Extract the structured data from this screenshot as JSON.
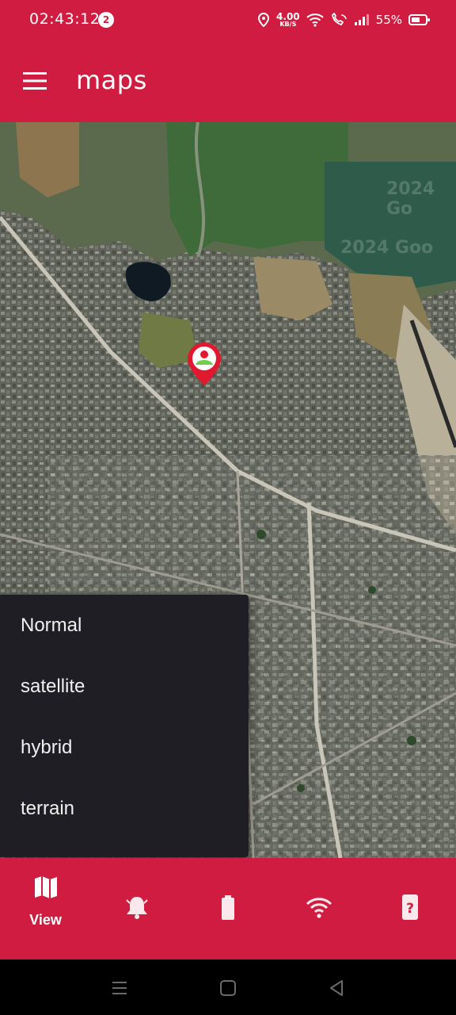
{
  "status_bar": {
    "time": "02:43:12",
    "notification_count": "2",
    "net_speed": "4.00",
    "net_speed_unit": "KB/S",
    "battery": "55%"
  },
  "app_bar": {
    "title": "maps"
  },
  "map": {
    "watermark_1": "2024 Go",
    "watermark_2": "2024 Goo"
  },
  "map_type_menu": {
    "items": [
      "Normal",
      "satellite",
      "hybrid",
      "terrain"
    ]
  },
  "bottom_nav": {
    "items": [
      {
        "icon": "map-icon",
        "label": "View",
        "active": true
      },
      {
        "icon": "bell-icon",
        "label": ""
      },
      {
        "icon": "battery-icon",
        "label": ""
      },
      {
        "icon": "wifi-icon",
        "label": ""
      },
      {
        "icon": "phone-help-icon",
        "label": ""
      }
    ]
  },
  "colors": {
    "primary": "#cf1c40",
    "menu_bg": "#1f1e24",
    "marker": "#e0192f"
  }
}
